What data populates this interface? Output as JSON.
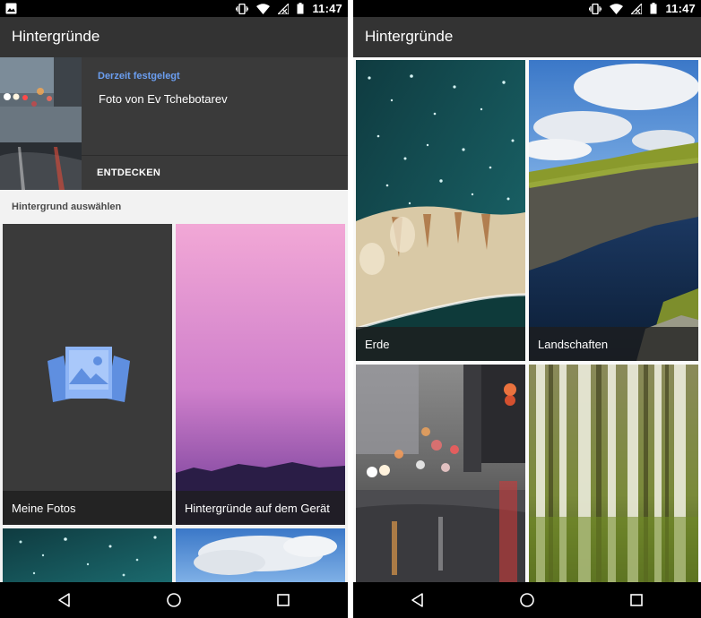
{
  "left": {
    "status": {
      "time": "11:47",
      "left_icon": "image-notification-icon",
      "icons": [
        "vibrate-icon",
        "wifi-icon",
        "no-signal-icon",
        "battery-icon"
      ]
    },
    "appbar": {
      "title": "Hintergründe"
    },
    "current": {
      "label": "Derzeit festgelegt",
      "credit": "Foto von Ev Tchebotarev",
      "explore": "ENTDECKEN"
    },
    "section_title": "Hintergrund auswählen",
    "tiles": [
      {
        "label": "Meine Fotos",
        "icon": "photos-icon"
      },
      {
        "label": "Hintergründe auf dem Gerät"
      }
    ],
    "nav": [
      "back-icon",
      "home-icon",
      "recents-icon"
    ]
  },
  "right": {
    "status": {
      "time": "11:47",
      "icons": [
        "vibrate-icon",
        "wifi-icon",
        "no-signal-icon",
        "battery-icon"
      ]
    },
    "appbar": {
      "title": "Hintergründe"
    },
    "tiles": [
      {
        "label": "Erde"
      },
      {
        "label": "Landschaften"
      }
    ],
    "nav": [
      "back-icon",
      "home-icon",
      "recents-icon"
    ]
  },
  "colors": {
    "appbar": "#333333",
    "accent_label": "#6b9ef0",
    "statusbar": "#000000",
    "photos_icon": "#7aa7f2"
  }
}
